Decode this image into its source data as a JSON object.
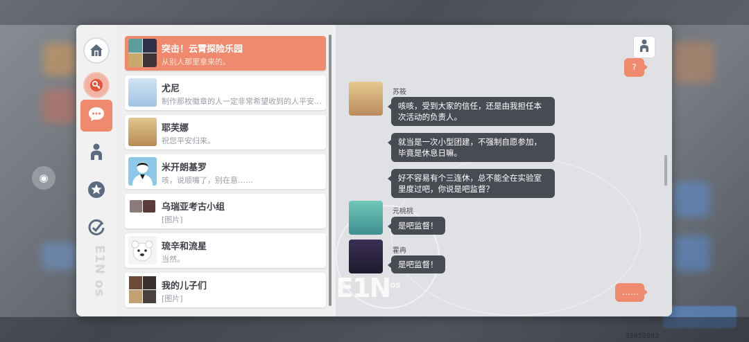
{
  "nav": {
    "items": [
      {
        "name": "home",
        "icon": "home-icon"
      },
      {
        "name": "events",
        "icon": "key-badge-icon"
      },
      {
        "name": "messages",
        "icon": "chat-bubble-icon",
        "active": true
      },
      {
        "name": "contacts",
        "icon": "person-icon"
      },
      {
        "name": "favorites",
        "icon": "star-icon"
      },
      {
        "name": "tasks",
        "icon": "check-ring-icon"
      }
    ],
    "watermark": "E1N os"
  },
  "conversations": [
    {
      "name": "突击！云霄探险乐园",
      "preview": "从别人那里拿来的。",
      "active": true,
      "avatar": "group-avatar"
    },
    {
      "name": "尤尼",
      "preview": "制作那枚徽章的人一定非常希望收到的人平安……",
      "avatar": "yuni-avatar"
    },
    {
      "name": "耶芙娜",
      "preview": "祝您平安归来。",
      "avatar": "yefna-avatar"
    },
    {
      "name": "米开朗基罗",
      "preview": "咳，说顺嘴了，别在意……",
      "avatar": "michelangelo-avatar"
    },
    {
      "name": "乌瑞亚考古小组",
      "preview": "[图片]",
      "avatar": "group-avatar"
    },
    {
      "name": "琉辛和流星",
      "preview": "当然。",
      "avatar": "pet-avatar"
    },
    {
      "name": "我的儿子们",
      "preview": "[图片]",
      "avatar": "group-avatar"
    }
  ],
  "chat": {
    "profile_icon": "person-icon",
    "messages": [
      {
        "from": "self",
        "text": "?"
      },
      {
        "from": "苏筱",
        "text": "咳咳，受到大家的信任，还是由我担任本次活动的负责人。"
      },
      {
        "from": "苏筱",
        "text": "就当是一次小型团建，不强制自愿参加，毕竟是休息日嘛。"
      },
      {
        "from": "苏筱",
        "text": "好不容易有个三连休，总不能全在实验室里度过吧，你说是吧监督？"
      },
      {
        "from": "元桃桃",
        "text": "是吧监督！"
      },
      {
        "from": "霍冉",
        "text": "是吧监督！"
      },
      {
        "from": "self",
        "text": "……"
      }
    ],
    "watermark": "E1N",
    "watermark_sup": "os"
  },
  "footer": {
    "uid": "38659982"
  },
  "colors": {
    "accent": "#ef8a6e",
    "bubble_dark": "#484b52"
  }
}
